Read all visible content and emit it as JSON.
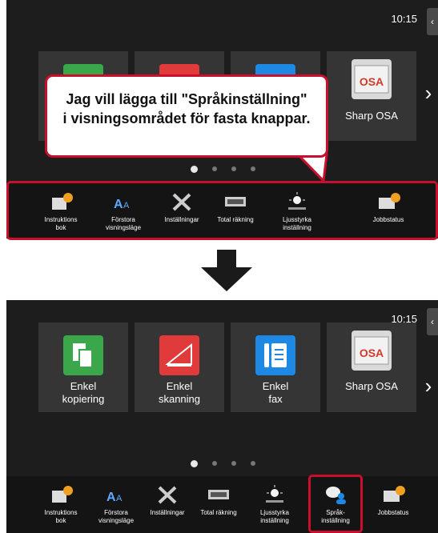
{
  "screen_top": {
    "clock": "10:15",
    "side_tab_glyph": "‹",
    "tiles": [
      {
        "label": "Sharp OSA"
      }
    ],
    "callout": {
      "line1": "Jag vill lägga till \"Språkinställning\"",
      "line2": "i visningsområdet för fasta knappar."
    },
    "bar_buttons": [
      {
        "line1": "Instruktions",
        "line2": "bok",
        "icon": "book-help-icon"
      },
      {
        "line1": "Förstora",
        "line2": "visningsläge",
        "icon": "text-enlarge-icon"
      },
      {
        "line1": "Inställningar",
        "line2": "",
        "icon": "tools-icon"
      },
      {
        "line1": "Total räkning",
        "line2": "",
        "icon": "counter-icon"
      },
      {
        "line1": "Ljusstyrka",
        "line2": "inställning",
        "icon": "brightness-icon"
      },
      {
        "line1": "Jobbstatus",
        "line2": "",
        "icon": "job-status-icon"
      }
    ]
  },
  "screen_bottom": {
    "clock": "10:15",
    "side_tab_glyph": "‹",
    "tiles": [
      {
        "line1": "Enkel",
        "line2": "kopiering",
        "icon": "copy-icon",
        "color": "#3aa84a"
      },
      {
        "line1": "Enkel",
        "line2": "skanning",
        "icon": "scan-icon",
        "color": "#e03a3a"
      },
      {
        "line1": "Enkel",
        "line2": "fax",
        "icon": "fax-icon",
        "color": "#1e88e5"
      },
      {
        "line1": "Sharp OSA",
        "line2": "",
        "icon": "sharp-osa-icon",
        "color": "#d9d9d9"
      }
    ],
    "bar_buttons": [
      {
        "line1": "Instruktions",
        "line2": "bok",
        "icon": "book-help-icon"
      },
      {
        "line1": "Förstora",
        "line2": "visningsläge",
        "icon": "text-enlarge-icon"
      },
      {
        "line1": "Inställningar",
        "line2": "",
        "icon": "tools-icon"
      },
      {
        "line1": "Total räkning",
        "line2": "",
        "icon": "counter-icon"
      },
      {
        "line1": "Ljusstyrka",
        "line2": "inställning",
        "icon": "brightness-icon"
      },
      {
        "line1": "Språk-",
        "line2": "inställning",
        "icon": "language-icon"
      },
      {
        "line1": "Jobbstatus",
        "line2": "",
        "icon": "job-status-icon"
      }
    ]
  },
  "next_glyph": "›",
  "colors": {
    "highlight": "#c8102e",
    "screen_bg": "#1d1d1d",
    "tile_bg": "#353535"
  }
}
